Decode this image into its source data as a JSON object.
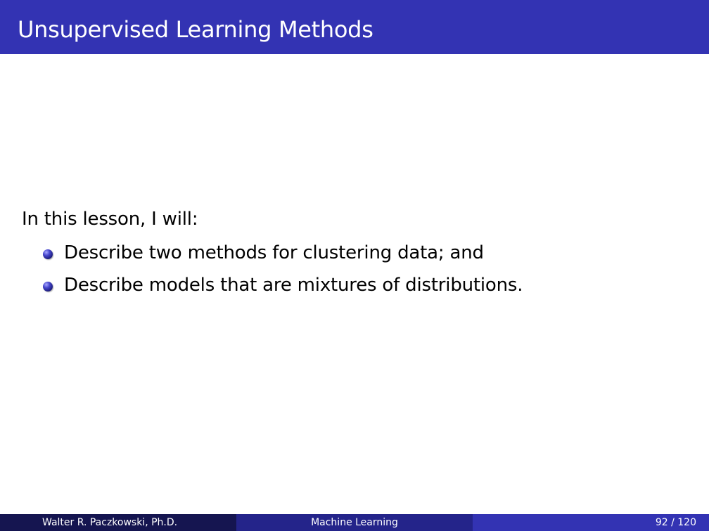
{
  "slide": {
    "title": "Unsupervised Learning Methods",
    "intro": "In this lesson, I will:",
    "bullets": [
      {
        "text": "Describe two methods for clustering data; and"
      },
      {
        "text": "Describe models that are mixtures of distributions."
      }
    ]
  },
  "footer": {
    "author": "Walter R. Paczkowski, Ph.D.",
    "course": "Machine Learning",
    "page": "92 / 120"
  },
  "colors": {
    "title_bar": "#3333b3",
    "footer_left": "#151550",
    "footer_middle": "#24248a",
    "footer_right": "#3333b3",
    "text": "#000000",
    "title_text": "#ffffff"
  }
}
